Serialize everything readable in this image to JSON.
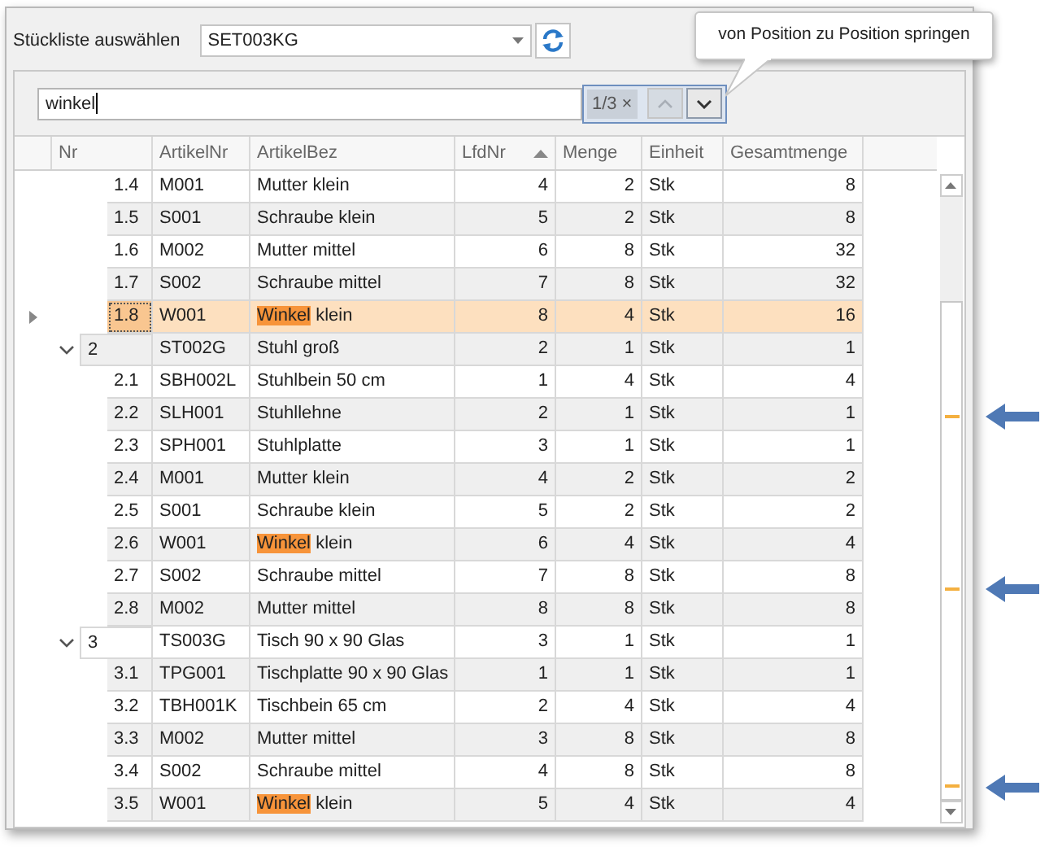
{
  "toolbar": {
    "label": "Stückliste auswählen",
    "combo_value": "SET003KG"
  },
  "search": {
    "value": "winkel",
    "match_count": "1/3",
    "clear": "×",
    "prev_disabled": true,
    "next_disabled": false
  },
  "tooltip": {
    "text": "von Position zu Position springen"
  },
  "table": {
    "columns": [
      {
        "label": "Nr",
        "sorted": false
      },
      {
        "label": "ArtikelNr",
        "sorted": false
      },
      {
        "label": "ArtikelBez",
        "sorted": false
      },
      {
        "label": "LfdNr",
        "sorted": true
      },
      {
        "label": "Menge",
        "sorted": false
      },
      {
        "label": "Einheit",
        "sorted": false
      },
      {
        "label": "Gesamtmenge",
        "sorted": false
      }
    ],
    "rows": [
      {
        "kind": "item",
        "nr": "1.4",
        "artikel_nr": "M001",
        "artikel_bez": [
          {
            "text": "Mutter klein",
            "highlighted": false
          }
        ],
        "lfd_nr": "4",
        "menge": "2",
        "einheit": "Stk",
        "gesamtmenge": "8",
        "selected": false
      },
      {
        "kind": "item",
        "nr": "1.5",
        "artikel_nr": "S001",
        "artikel_bez": [
          {
            "text": "Schraube klein",
            "highlighted": false
          }
        ],
        "lfd_nr": "5",
        "menge": "2",
        "einheit": "Stk",
        "gesamtmenge": "8",
        "selected": false
      },
      {
        "kind": "item",
        "nr": "1.6",
        "artikel_nr": "M002",
        "artikel_bez": [
          {
            "text": "Mutter mittel",
            "highlighted": false
          }
        ],
        "lfd_nr": "6",
        "menge": "8",
        "einheit": "Stk",
        "gesamtmenge": "32",
        "selected": false
      },
      {
        "kind": "item",
        "nr": "1.7",
        "artikel_nr": "S002",
        "artikel_bez": [
          {
            "text": "Schraube mittel",
            "highlighted": false
          }
        ],
        "lfd_nr": "7",
        "menge": "8",
        "einheit": "Stk",
        "gesamtmenge": "32",
        "selected": false
      },
      {
        "kind": "item",
        "nr": "1.8",
        "artikel_nr": "W001",
        "artikel_bez": [
          {
            "text": "Winkel",
            "highlighted": true
          },
          {
            "text": " klein",
            "highlighted": false
          }
        ],
        "lfd_nr": "8",
        "menge": "4",
        "einheit": "Stk",
        "gesamtmenge": "16",
        "selected": true
      },
      {
        "kind": "group",
        "expanded": true,
        "nr": "2",
        "artikel_nr": "ST002G",
        "artikel_bez": [
          {
            "text": "Stuhl groß",
            "highlighted": false
          }
        ],
        "lfd_nr": "2",
        "menge": "1",
        "einheit": "Stk",
        "gesamtmenge": "1",
        "selected": false
      },
      {
        "kind": "item",
        "nr": "2.1",
        "artikel_nr": "SBH002L",
        "artikel_bez": [
          {
            "text": "Stuhlbein 50 cm",
            "highlighted": false
          }
        ],
        "lfd_nr": "1",
        "menge": "4",
        "einheit": "Stk",
        "gesamtmenge": "4",
        "selected": false
      },
      {
        "kind": "item",
        "nr": "2.2",
        "artikel_nr": "SLH001",
        "artikel_bez": [
          {
            "text": "Stuhllehne",
            "highlighted": false
          }
        ],
        "lfd_nr": "2",
        "menge": "1",
        "einheit": "Stk",
        "gesamtmenge": "1",
        "selected": false
      },
      {
        "kind": "item",
        "nr": "2.3",
        "artikel_nr": "SPH001",
        "artikel_bez": [
          {
            "text": "Stuhlplatte",
            "highlighted": false
          }
        ],
        "lfd_nr": "3",
        "menge": "1",
        "einheit": "Stk",
        "gesamtmenge": "1",
        "selected": false
      },
      {
        "kind": "item",
        "nr": "2.4",
        "artikel_nr": "M001",
        "artikel_bez": [
          {
            "text": "Mutter klein",
            "highlighted": false
          }
        ],
        "lfd_nr": "4",
        "menge": "2",
        "einheit": "Stk",
        "gesamtmenge": "2",
        "selected": false
      },
      {
        "kind": "item",
        "nr": "2.5",
        "artikel_nr": "S001",
        "artikel_bez": [
          {
            "text": "Schraube klein",
            "highlighted": false
          }
        ],
        "lfd_nr": "5",
        "menge": "2",
        "einheit": "Stk",
        "gesamtmenge": "2",
        "selected": false
      },
      {
        "kind": "item",
        "nr": "2.6",
        "artikel_nr": "W001",
        "artikel_bez": [
          {
            "text": "Winkel",
            "highlighted": true
          },
          {
            "text": " klein",
            "highlighted": false
          }
        ],
        "lfd_nr": "6",
        "menge": "4",
        "einheit": "Stk",
        "gesamtmenge": "4",
        "selected": false
      },
      {
        "kind": "item",
        "nr": "2.7",
        "artikel_nr": "S002",
        "artikel_bez": [
          {
            "text": "Schraube mittel",
            "highlighted": false
          }
        ],
        "lfd_nr": "7",
        "menge": "8",
        "einheit": "Stk",
        "gesamtmenge": "8",
        "selected": false
      },
      {
        "kind": "item",
        "nr": "2.8",
        "artikel_nr": "M002",
        "artikel_bez": [
          {
            "text": "Mutter mittel",
            "highlighted": false
          }
        ],
        "lfd_nr": "8",
        "menge": "8",
        "einheit": "Stk",
        "gesamtmenge": "8",
        "selected": false
      },
      {
        "kind": "group",
        "expanded": true,
        "nr": "3",
        "artikel_nr": "TS003G",
        "artikel_bez": [
          {
            "text": "Tisch 90 x 90 Glas",
            "highlighted": false
          }
        ],
        "lfd_nr": "3",
        "menge": "1",
        "einheit": "Stk",
        "gesamtmenge": "1",
        "selected": false
      },
      {
        "kind": "item",
        "nr": "3.1",
        "artikel_nr": "TPG001",
        "artikel_bez": [
          {
            "text": "Tischplatte 90 x 90 Glas",
            "highlighted": false
          }
        ],
        "lfd_nr": "1",
        "menge": "1",
        "einheit": "Stk",
        "gesamtmenge": "1",
        "selected": false
      },
      {
        "kind": "item",
        "nr": "3.2",
        "artikel_nr": "TBH001K",
        "artikel_bez": [
          {
            "text": "Tischbein 65 cm",
            "highlighted": false
          }
        ],
        "lfd_nr": "2",
        "menge": "4",
        "einheit": "Stk",
        "gesamtmenge": "4",
        "selected": false
      },
      {
        "kind": "item",
        "nr": "3.3",
        "artikel_nr": "M002",
        "artikel_bez": [
          {
            "text": "Mutter mittel",
            "highlighted": false
          }
        ],
        "lfd_nr": "3",
        "menge": "8",
        "einheit": "Stk",
        "gesamtmenge": "8",
        "selected": false
      },
      {
        "kind": "item",
        "nr": "3.4",
        "artikel_nr": "S002",
        "artikel_bez": [
          {
            "text": "Schraube mittel",
            "highlighted": false
          }
        ],
        "lfd_nr": "4",
        "menge": "8",
        "einheit": "Stk",
        "gesamtmenge": "8",
        "selected": false
      },
      {
        "kind": "item",
        "nr": "3.5",
        "artikel_nr": "W001",
        "artikel_bez": [
          {
            "text": "Winkel",
            "highlighted": true
          },
          {
            "text": " klein",
            "highlighted": false
          }
        ],
        "lfd_nr": "5",
        "menge": "4",
        "einheit": "Stk",
        "gesamtmenge": "4",
        "selected": false
      }
    ]
  }
}
